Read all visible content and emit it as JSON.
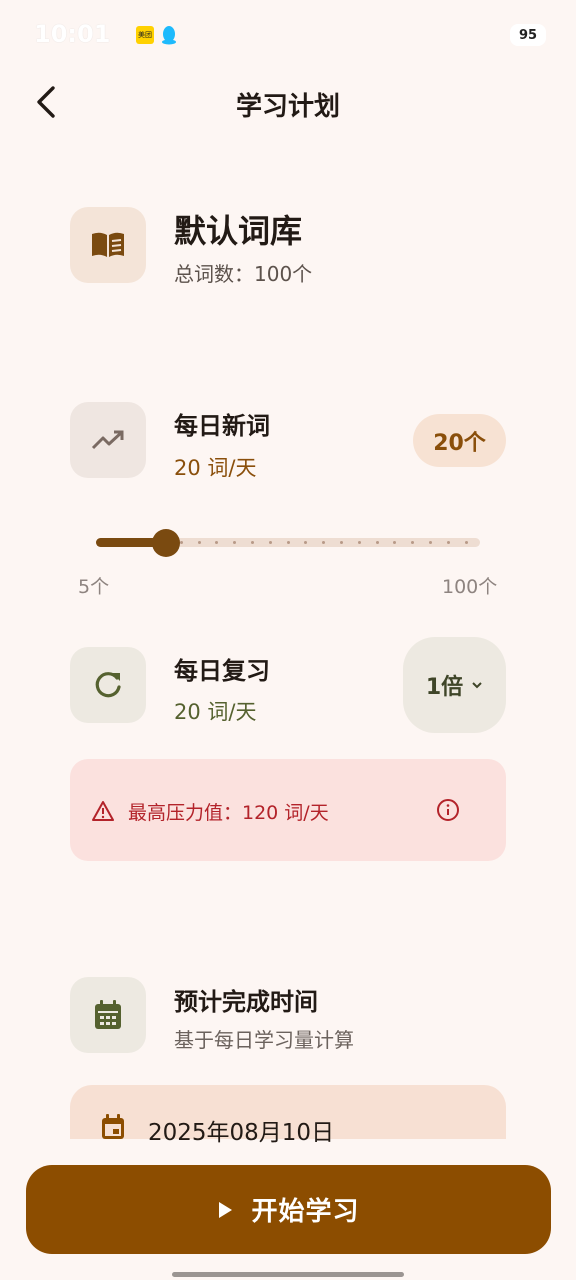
{
  "status_bar": {
    "time": "10:01",
    "middle_text": "",
    "meituan_text": "美团",
    "right_text": "",
    "battery": "95"
  },
  "header": {
    "title": "学习计划"
  },
  "library": {
    "name": "默认词库",
    "count": "总词数：100个"
  },
  "daily_new": {
    "title": "每日新词",
    "rate": "20 词/天",
    "badge": "20个",
    "slider": {
      "min_label": "5个",
      "max_label": "100个",
      "min": 5,
      "max": 100,
      "value": 20,
      "steps": 20
    }
  },
  "daily_review": {
    "title": "每日复习",
    "rate": "20 词/天",
    "multiplier": "1倍"
  },
  "warning": {
    "text": "最高压力值：120 词/天"
  },
  "finish": {
    "title": "预计完成时间",
    "subtitle": "基于每日学习量计算",
    "date": "2025年08月10日"
  },
  "start_button": {
    "label": "开始学习"
  },
  "colors": {
    "background": "#FDF6F3",
    "primary": "#8C4D00",
    "review_accent": "#55612F",
    "warning_bg": "#FBE1DE",
    "warning_text": "#B3232A"
  }
}
